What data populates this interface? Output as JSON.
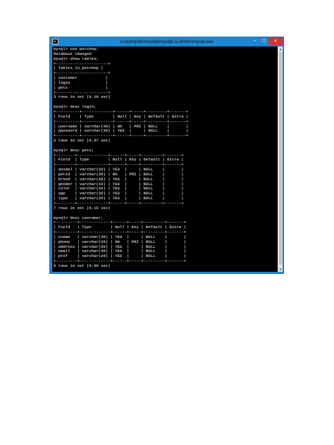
{
  "window": {
    "title": "c:\\wamp\\bin\\mysql\\mysql5.5.24\\bin\\mysql.exe",
    "minimize_glyph": "─",
    "maximize_glyph": "☐",
    "close_glyph": "✕",
    "icon": "console-app-icon"
  },
  "console": {
    "text": "mysql> use petchop;\nDatabase changed\nmysql> show tables;\n+----------------------+\n| Tables_in_petchop |\n+----------------------+\n| customer            |\n| login               |\n| pets                |\n+----------------------+\n3 rows in set (0.10 sec)\n\nmysql> desc login;\n+----------+-------------+------+-----+---------+-------+\n| Field    | Type        | Null | Key | Default | Extra |\n+----------+-------------+------+-----+---------+-------+\n| username | varchar(40) | NO   | PRI | NULL    |       |\n| password | varchar(30) | YES  |     | NULL    |       |\n+----------+-------------+------+-----+---------+-------+\n2 rows in set (0.07 sec)\n\nmysql> desc pets;\n+--------+-------------+------+-----+---------+-------+\n| Field  | Type        | Null | Key | Default | Extra |\n+--------+-------------+------+-----+---------+-------+\n| animal | varchar(20) | YES  |     | NULL    |       |\n| petid  | varchar(30) | NO   | PRI | NULL    |       |\n| breed  | varchar(30) | YES  |     | NULL    |       |\n| gender | varchar(10) | YES  |     | NULL    |       |\n| color  | varchar(20) | YES  |     | NULL    |       |\n| age    | varchar(20) | YES  |     | NULL    |       |\n| type   | varchar(20) | YES  |     | NULL    |       |\n+--------+-------------+------+-----+---------+-------+\n7 rows in set (0.15 sec)\n\nmysql> desc customer;\n+---------+-------------+------+-----+---------+-------+\n| Field   | Type        | Null | Key | Default | Extra |\n+---------+-------------+------+-----+---------+-------+\n| cname   | varchar(30) | YES  |     | NULL    |       |\n| phone   | varchar(20) | NO   | PRI | NULL    |       |\n| address | varchar(50) | YES  |     | NULL    |       |\n| email   | varchar(40) | YES  |     | NULL    |       |\n| pref    | varchar(20) | YES  |     | NULL    |       |\n+---------+-------------+------+-----+---------+-------+\n5 rows in set (0.08 sec)\n\nmysql>"
  },
  "scrollbar": {
    "up_glyph": "▲",
    "down_glyph": "▼"
  }
}
